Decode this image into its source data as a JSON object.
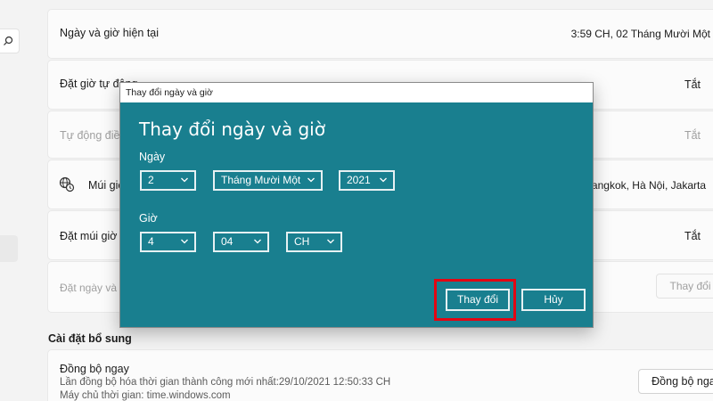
{
  "background_rows": {
    "current_datetime": {
      "label": "Ngày và giờ hiện tại",
      "value": "3:59 CH, 02 Tháng Mười Một"
    },
    "auto_time": {
      "label": "Đặt giờ tự động",
      "state": "Tắt"
    },
    "auto_dst": {
      "label": "Tự động điều",
      "state": "Tắt"
    },
    "timezone": {
      "label": "Múi giờ",
      "value": ") Bangkok, Hà Nội, Jakarta"
    },
    "auto_timezone": {
      "label": "Đặt múi giờ tự",
      "state": "Tắt"
    },
    "manual_set": {
      "label": "Đặt ngày và giờ",
      "button": "Thay đổi"
    }
  },
  "additional": {
    "section_title": "Cài đặt bổ sung",
    "sync_title": "Đồng bộ ngay",
    "sync_last": "Lần đồng bộ hóa thời gian thành công mới nhất:29/10/2021 12:50:33 CH",
    "sync_server": "Máy chủ thời gian: time.windows.com",
    "sync_button": "Đồng bộ ngay"
  },
  "dialog": {
    "window_title": "Thay đổi ngày và giờ",
    "heading": "Thay đổi ngày và giờ",
    "date_label": "Ngày",
    "day": "2",
    "month": "Tháng Mười Một",
    "year": "2021",
    "time_label": "Giờ",
    "hour": "4",
    "minute": "04",
    "ampm": "CH",
    "change_button": "Thay đổi",
    "cancel_button": "Hủy"
  },
  "colors": {
    "dialog_bg": "#197f8f",
    "highlight": "#e30613"
  }
}
